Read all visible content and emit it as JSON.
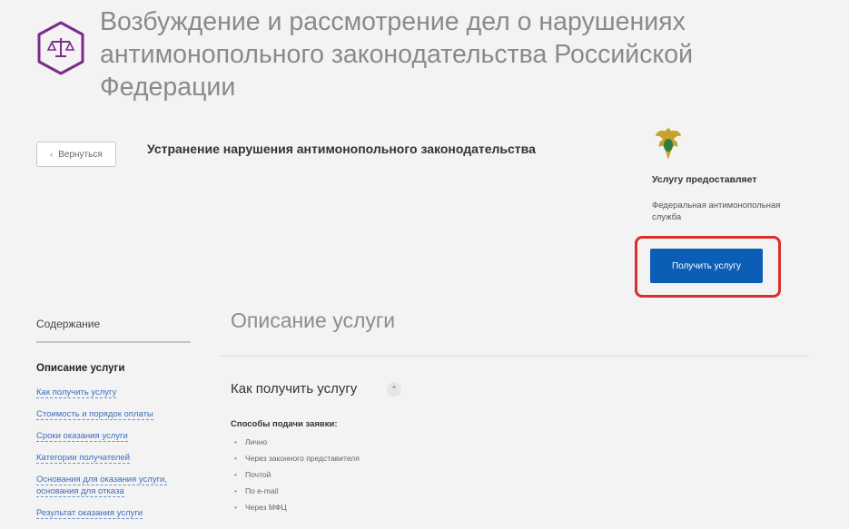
{
  "header": {
    "title": "Возбуждение и рассмотрение дел о нарушениях антимонопольного законодательства Российской Федерации",
    "icon": "scales-icon"
  },
  "nav": {
    "back_label": "Вернуться"
  },
  "service": {
    "subtitle": "Устранение нарушения антимонопольного законодательства"
  },
  "provider": {
    "label": "Услугу предоставляет",
    "name": "Федеральная антимонопольная служба",
    "emblem": "emblem-icon"
  },
  "actions": {
    "get_service_label": "Получить услугу"
  },
  "toc": {
    "title": "Содержание",
    "active": "Описание услуги",
    "items": [
      "Как получить услугу",
      "Стоимость и порядок оплаты",
      "Сроки оказания услуги",
      "Категории получателей",
      "Основания для оказания услуги, основания для отказа",
      "Результат оказания услуги"
    ]
  },
  "content": {
    "heading": "Описание услуги",
    "how_heading": "Как получить услугу",
    "methods_label": "Способы подачи заявки:",
    "methods": [
      "Лично",
      "Через законного представителя",
      "Почтой",
      "По e-mail",
      "Через МФЦ"
    ]
  },
  "colors": {
    "primary": "#0b5db5",
    "highlight": "#d9302a",
    "link": "#3b6dbf",
    "brand": "#7b2b8c"
  }
}
